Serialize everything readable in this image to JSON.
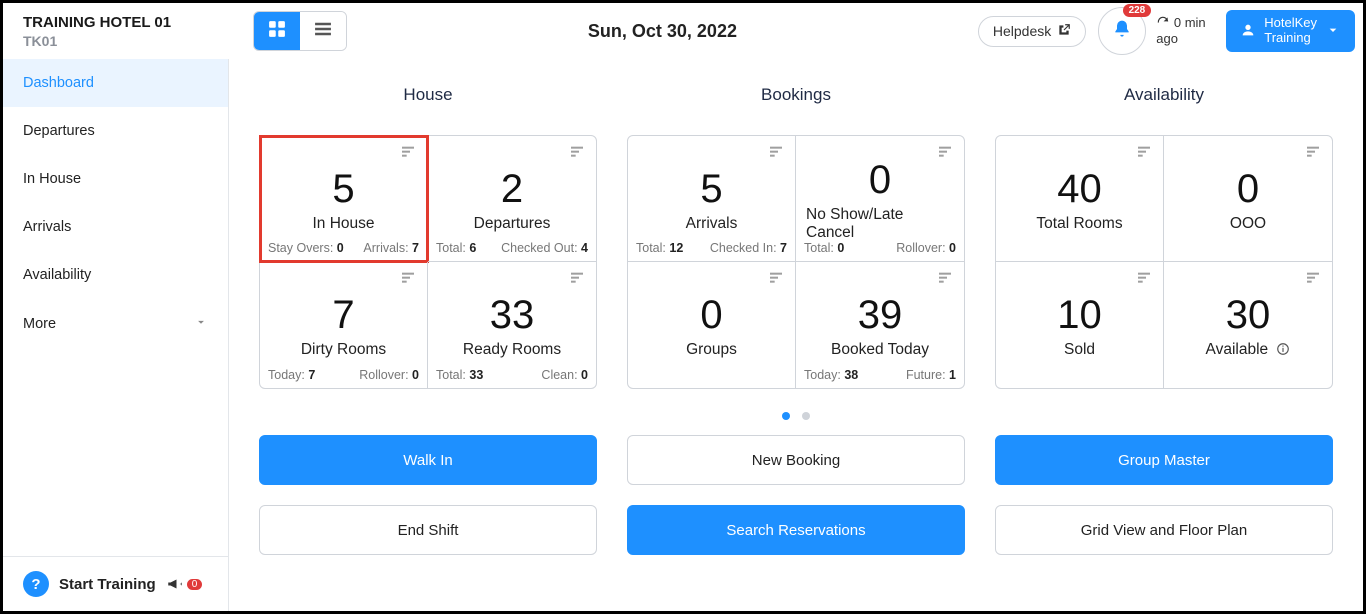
{
  "header": {
    "hotel_name": "TRAINING HOTEL 01",
    "hotel_code": "TK01",
    "date": "Sun, Oct 30, 2022",
    "helpdesk": "Helpdesk",
    "notif_count": "228",
    "sync_line1": "0 min",
    "sync_line2": "ago",
    "profile_line1": "HotelKey",
    "profile_line2": "Training"
  },
  "sidebar": {
    "items": [
      "Dashboard",
      "Departures",
      "In House",
      "Arrivals",
      "Availability",
      "More"
    ],
    "start_training": "Start Training",
    "start_badge": "0"
  },
  "columns": {
    "house": "House",
    "bookings": "Bookings",
    "availability": "Availability"
  },
  "house": {
    "inhouse": {
      "big": "5",
      "label": "In House",
      "f1l": "Stay Overs:",
      "f1v": "0",
      "f2l": "Arrivals:",
      "f2v": "7"
    },
    "departures": {
      "big": "2",
      "label": "Departures",
      "f1l": "Total:",
      "f1v": "6",
      "f2l": "Checked Out:",
      "f2v": "4"
    },
    "dirty": {
      "big": "7",
      "label": "Dirty Rooms",
      "f1l": "Today:",
      "f1v": "7",
      "f2l": "Rollover:",
      "f2v": "0"
    },
    "ready": {
      "big": "33",
      "label": "Ready Rooms",
      "f1l": "Total:",
      "f1v": "33",
      "f2l": "Clean:",
      "f2v": "0"
    }
  },
  "bookings": {
    "arrivals": {
      "big": "5",
      "label": "Arrivals",
      "f1l": "Total:",
      "f1v": "12",
      "f2l": "Checked In:",
      "f2v": "7"
    },
    "noshow": {
      "big": "0",
      "label": "No Show/Late Cancel",
      "f1l": "Total:",
      "f1v": "0",
      "f2l": "Rollover:",
      "f2v": "0"
    },
    "groups": {
      "big": "0",
      "label": "Groups"
    },
    "booked": {
      "big": "39",
      "label": "Booked Today",
      "f1l": "Today:",
      "f1v": "38",
      "f2l": "Future:",
      "f2v": "1"
    }
  },
  "availability": {
    "total": {
      "big": "40",
      "label": "Total Rooms"
    },
    "ooo": {
      "big": "0",
      "label": "OOO"
    },
    "sold": {
      "big": "10",
      "label": "Sold"
    },
    "available": {
      "big": "30",
      "label": "Available"
    }
  },
  "buttons": {
    "row1": [
      "Walk In",
      "New Booking",
      "Group Master"
    ],
    "row2": [
      "End Shift",
      "Search Reservations",
      "Grid View and Floor Plan"
    ]
  }
}
